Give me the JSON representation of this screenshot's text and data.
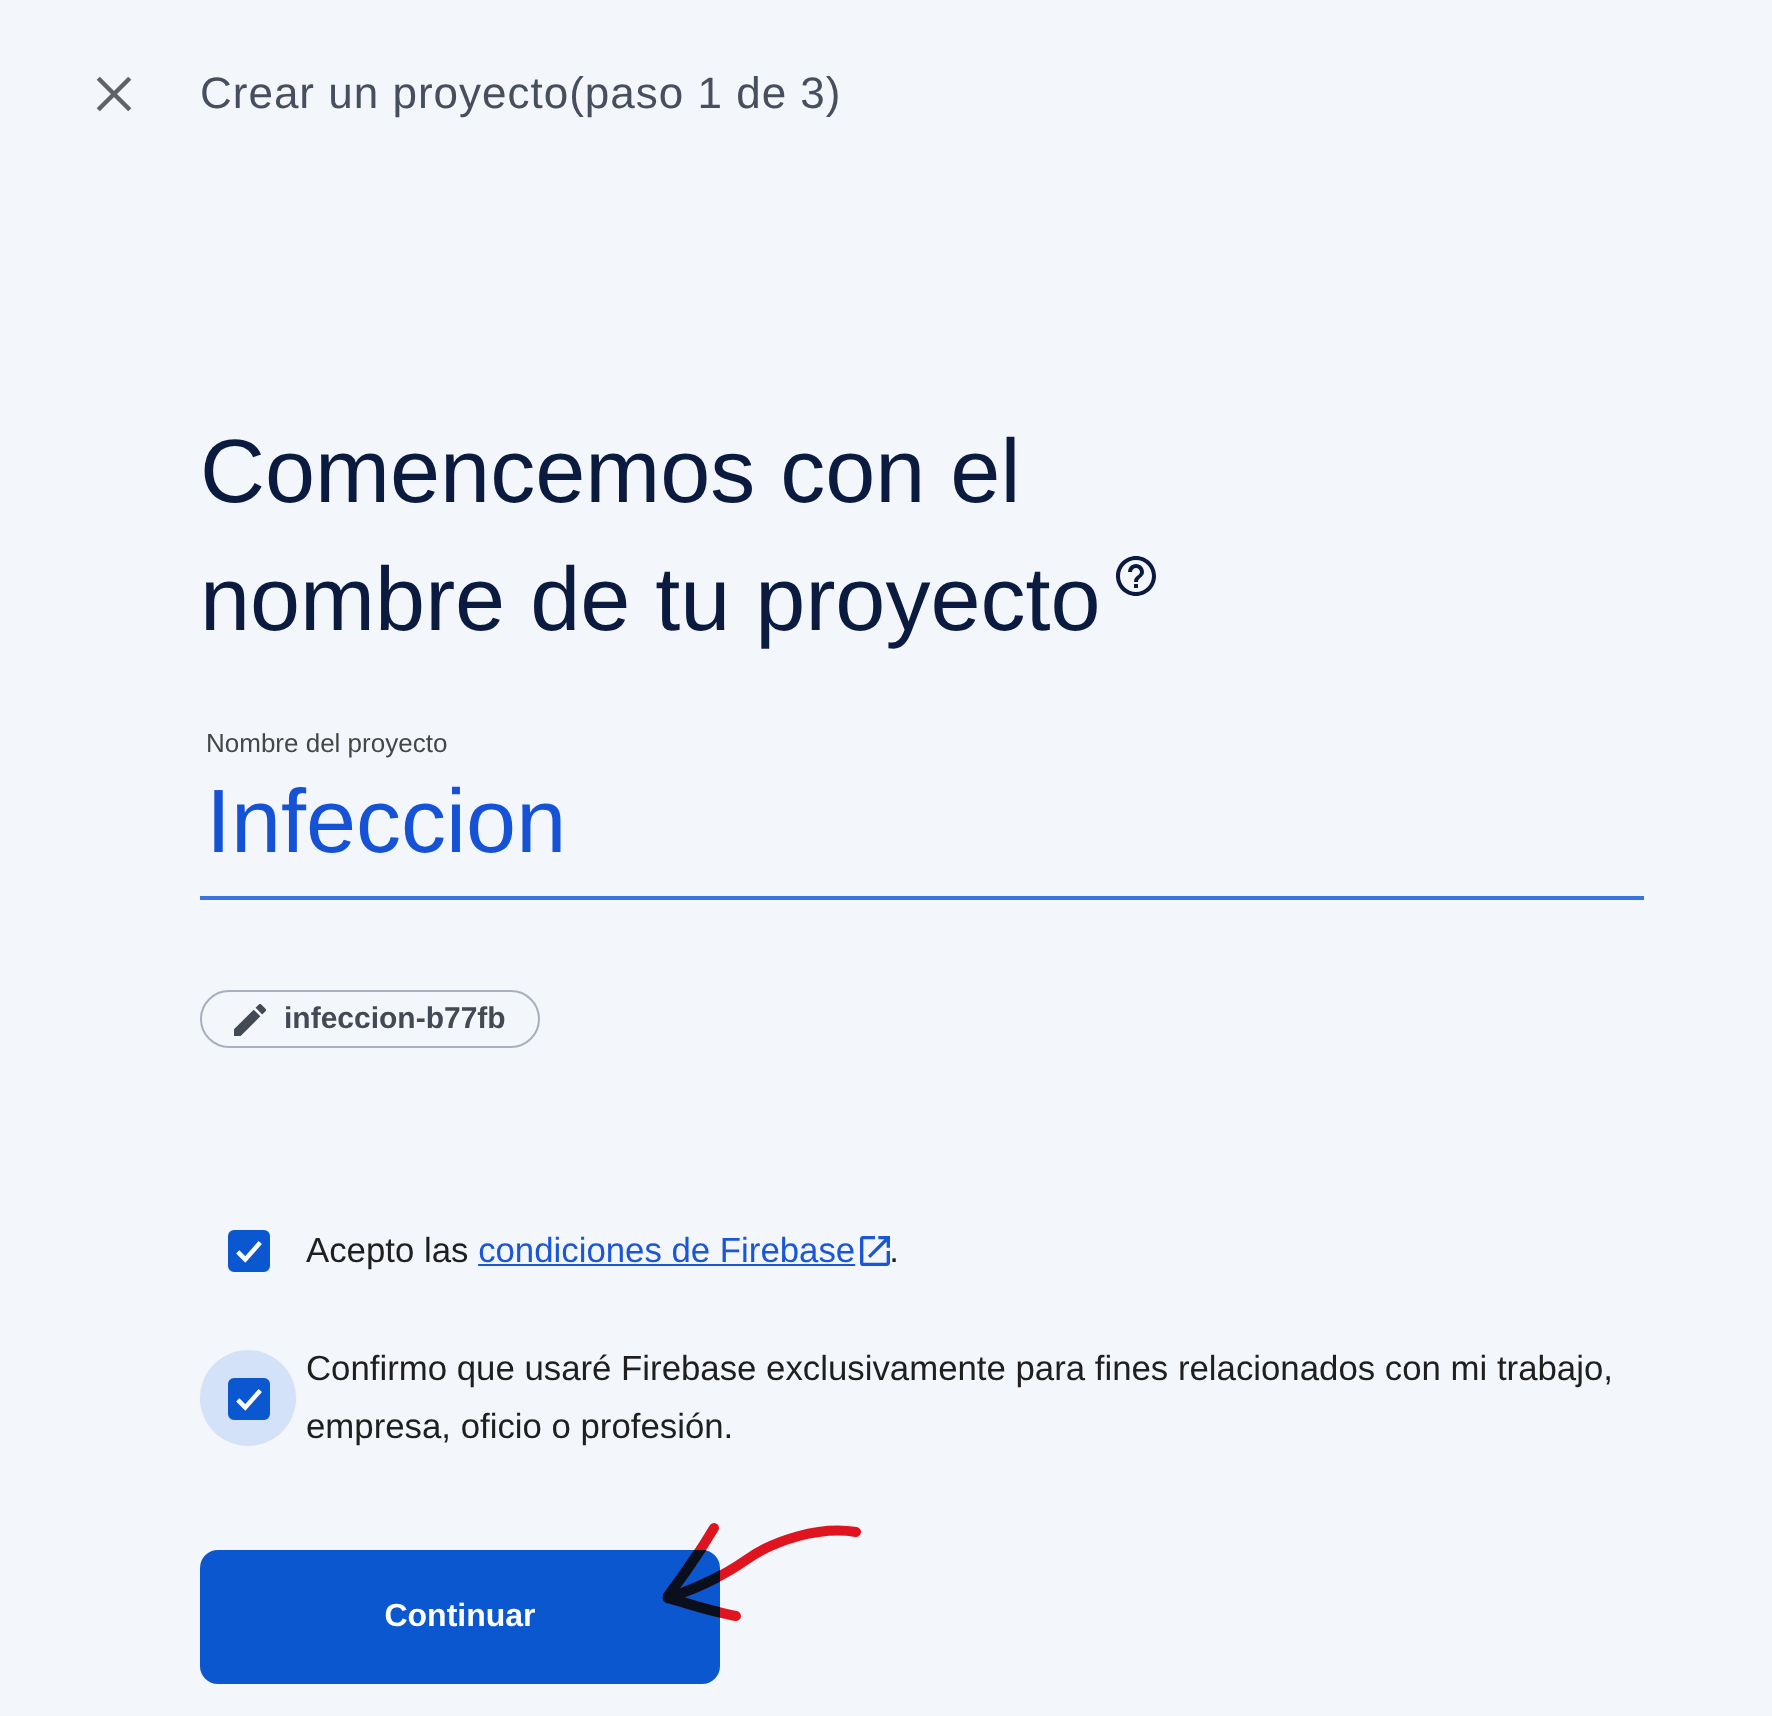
{
  "header": {
    "title": "Crear un proyecto(paso 1 de 3)"
  },
  "heading": {
    "text": "Comencemos con el nombre de tu proyecto"
  },
  "project_name": {
    "label": "Nombre del proyecto",
    "value": "Infeccion"
  },
  "project_id": {
    "text": "infeccion-b77fb"
  },
  "checkboxes": [
    {
      "checked": true,
      "focused": false,
      "text": "Acepto las",
      "link": "condiciones de Firebase",
      "text_after": "."
    },
    {
      "checked": true,
      "focused": true,
      "text": "Confirmo que usaré Firebase exclusivamente para fines relacionados con mi trabajo, empresa, oficio o profesión."
    }
  ],
  "button": {
    "label": "Continuar"
  }
}
